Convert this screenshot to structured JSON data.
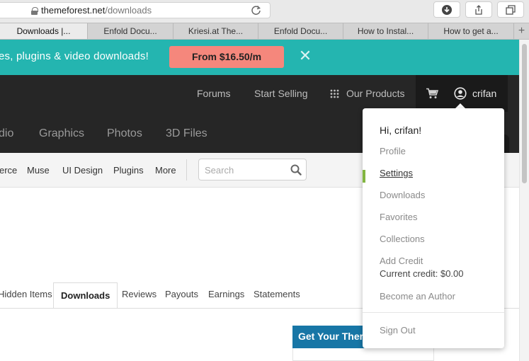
{
  "browser": {
    "url_domain": "themeforest.net",
    "url_path": "/downloads",
    "tabs": [
      {
        "label": "Downloads |..."
      },
      {
        "label": "Enfold Docu..."
      },
      {
        "label": "Kriesi.at The..."
      },
      {
        "label": "Enfold Docu..."
      },
      {
        "label": "How to Instal..."
      },
      {
        "label": "How to get a..."
      }
    ],
    "new_tab_symbol": "+"
  },
  "promo": {
    "text": "es, plugins & video downloads!",
    "button_label": "From $16.50/m",
    "close_symbol": "✕",
    "colors": {
      "background": "#24b5b0",
      "button": "#f5877c"
    }
  },
  "header": {
    "links": {
      "forums": "Forums",
      "start_selling": "Start Selling",
      "our_products": "Our Products"
    },
    "username": "crifan"
  },
  "categories": [
    "dio",
    "Graphics",
    "Photos",
    "3D Files"
  ],
  "subnav": {
    "links": [
      "erce",
      "Muse",
      "UI Design",
      "Plugins",
      "More"
    ],
    "search_placeholder": "Search"
  },
  "profile_tabs": [
    "Hidden Items",
    "Downloads",
    "Reviews",
    "Payouts",
    "Earnings",
    "Statements"
  ],
  "active_profile_tab": "Downloads",
  "sidebar_box": {
    "title": "Get Your Ther"
  },
  "dropdown": {
    "greeting": "Hi, crifan!",
    "items": {
      "profile": "Profile",
      "settings": "Settings",
      "downloads": "Downloads",
      "favorites": "Favorites",
      "collections": "Collections",
      "add_credit": "Add Credit",
      "credit_line": "Current credit: $0.00",
      "become_author": "Become an Author",
      "sign_out": "Sign Out"
    },
    "active_item": "Settings",
    "accent_color": "#82b541"
  }
}
